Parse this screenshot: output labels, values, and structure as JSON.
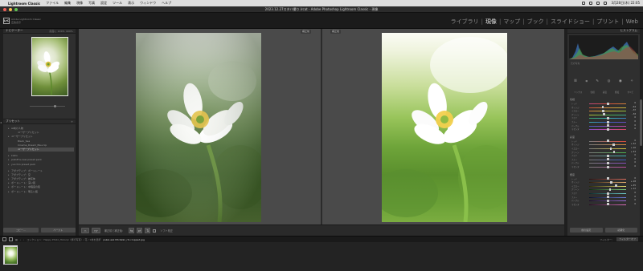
{
  "menubar": {
    "app_name": "Lightroom Classic",
    "menus": [
      "ファイル",
      "編集",
      "現像",
      "写真",
      "設定",
      "ツール",
      "表示",
      "ウィンドウ",
      "ヘルプ"
    ],
    "clock": "3月28日(木) 22:05"
  },
  "window": {
    "title": "2023.12.27スタバ撮り.lrcat - Adobe Photoshop Lightroom Classic - 現像"
  },
  "identity": {
    "logo": "LrC",
    "line1": "Adobe Lightroom Classic",
    "line2": "広告表示"
  },
  "modules": [
    "ライブラリ",
    "現像",
    "マップ",
    "ブック",
    "スライドショー",
    "プリント",
    "Web"
  ],
  "active_module": "現像",
  "navigator": {
    "title": "ナビゲーター",
    "options": "画面に  100%  400%"
  },
  "presets": {
    "title": "プリセット",
    "items": [
      {
        "label": "AI向け人物",
        "level": 0,
        "selected": false
      },
      {
        "label": "ユーザープリセット",
        "level": 1,
        "selected": false
      },
      {
        "label": "ユーザープリセット",
        "level": 0,
        "selected": false
      },
      {
        "label": "Black_Sea",
        "level": 1,
        "selected": false
      },
      {
        "label": "Cinema_Dream_Blue Up",
        "level": 1,
        "selected": false
      },
      {
        "label": "ユーザープリセット",
        "level": 1,
        "selected": true
      },
      {
        "label": "",
        "level": -1,
        "selected": false
      },
      {
        "label": "kisho",
        "level": 0,
        "selected": false
      },
      {
        "label": "Josh#h+new preset pack",
        "level": 0,
        "selected": false
      },
      {
        "label": "yucchin preset pack",
        "level": 0,
        "selected": false
      },
      {
        "label": "",
        "level": -1,
        "selected": false
      },
      {
        "label": "アダプティブ：ポートレート",
        "level": 0,
        "selected": false
      },
      {
        "label": "アダプティブ：空",
        "level": 0,
        "selected": false
      },
      {
        "label": "アダプティブ：被写体",
        "level": 0,
        "selected": false
      },
      {
        "label": "ポートレート：深い肌",
        "level": 0,
        "selected": false
      },
      {
        "label": "ポートレート：中程度の肌",
        "level": 0,
        "selected": false
      },
      {
        "label": "ポートレート：明るい肌",
        "level": 0,
        "selected": false
      }
    ]
  },
  "left_buttons": {
    "copy": "コピー...",
    "paste": "ペースト"
  },
  "compare": {
    "before_label": "補正前",
    "after_label": "補正後"
  },
  "toolbar": {
    "view_yy": "Y|Y",
    "before_after_label": "補正前と補正後：",
    "soft_proof_label": "ソフト校正"
  },
  "histogram": {
    "title": "ヒストグラム",
    "info": "元の写真"
  },
  "develop_panel": {
    "tabs": [
      "ミックス",
      "色相",
      "彩度",
      "輝度",
      "すべて"
    ],
    "sections": [
      {
        "name": "色相",
        "rows": [
          {
            "label": "レッド",
            "value": "0",
            "knob": 0.5,
            "gradient": "linear-gradient(90deg,#c04a7c,#d44a3a,#d2843a)"
          },
          {
            "label": "オレンジ",
            "value": "- 44",
            "knob": 0.36,
            "gradient": "linear-gradient(90deg,#c8503c,#d8903a,#c9b53a)"
          },
          {
            "label": "イエロー",
            "value": "- 37",
            "knob": 0.38,
            "gradient": "linear-gradient(90deg,#d2843a,#d6c23c,#8cbb3a)"
          },
          {
            "label": "グリーン",
            "value": "- 33",
            "knob": 0.4,
            "gradient": "linear-gradient(90deg,#b4c03a,#4fb04a,#3aa88c)"
          },
          {
            "label": "アクア",
            "value": "0",
            "knob": 0.5,
            "gradient": "linear-gradient(90deg,#3aa870,#3ab0b0,#3a7cc0)"
          },
          {
            "label": "ブルー",
            "value": "0",
            "knob": 0.5,
            "gradient": "linear-gradient(90deg,#3aa8b0,#3a5cc0,#6a4cc0)"
          },
          {
            "label": "パープル",
            "value": "0",
            "knob": 0.5,
            "gradient": "linear-gradient(90deg,#4a5cc0,#8a4cc0,#c04aa0)"
          },
          {
            "label": "マゼンタ",
            "value": "0",
            "knob": 0.5,
            "gradient": "linear-gradient(90deg,#8a4cc0,#c04aa0,#d04a5c)"
          }
        ]
      },
      {
        "name": "彩度",
        "rows": [
          {
            "label": "レッド",
            "value": "0",
            "knob": 0.5,
            "gradient": "linear-gradient(90deg,#7a7a7a,#d84a3a)"
          },
          {
            "label": "オレンジ",
            "value": "+ 32",
            "knob": 0.66,
            "gradient": "linear-gradient(90deg,#7a7a7a,#dc8a3a)"
          },
          {
            "label": "イエロー",
            "value": "+ 16",
            "knob": 0.58,
            "gradient": "linear-gradient(90deg,#7a7a7a,#d8c43a)"
          },
          {
            "label": "グリーン",
            "value": "+ 33",
            "knob": 0.67,
            "gradient": "linear-gradient(90deg,#7a7a7a,#4ab04a)"
          },
          {
            "label": "アクア",
            "value": "0",
            "knob": 0.5,
            "gradient": "linear-gradient(90deg,#7a7a7a,#3ab0b0)"
          },
          {
            "label": "ブルー",
            "value": "0",
            "knob": 0.5,
            "gradient": "linear-gradient(90deg,#7a7a7a,#3a5cc0)"
          },
          {
            "label": "パープル",
            "value": "0",
            "knob": 0.5,
            "gradient": "linear-gradient(90deg,#7a7a7a,#8a4cc0)"
          },
          {
            "label": "マゼンタ",
            "value": "0",
            "knob": 0.5,
            "gradient": "linear-gradient(90deg,#7a7a7a,#c04aa0)"
          }
        ]
      },
      {
        "name": "輝度",
        "rows": [
          {
            "label": "レッド",
            "value": "0",
            "knob": 0.5,
            "gradient": "linear-gradient(90deg,#2a1010,#e07060)"
          },
          {
            "label": "オレンジ",
            "value": "+ 18",
            "knob": 0.59,
            "gradient": "linear-gradient(90deg,#2a1a0a,#e8b070)"
          },
          {
            "label": "イエロー",
            "value": "+ 45",
            "knob": 0.72,
            "gradient": "linear-gradient(90deg,#2a2a0a,#ece070)"
          },
          {
            "label": "グリーン",
            "value": "+ 12",
            "knob": 0.56,
            "gradient": "linear-gradient(90deg,#102a10,#80d080)"
          },
          {
            "label": "アクア",
            "value": "0",
            "knob": 0.5,
            "gradient": "linear-gradient(90deg,#0a2a2a,#70d0d0)"
          },
          {
            "label": "ブルー",
            "value": "0",
            "knob": 0.5,
            "gradient": "linear-gradient(90deg,#0a102a,#7080e0)"
          },
          {
            "label": "パープル",
            "value": "0",
            "knob": 0.5,
            "gradient": "linear-gradient(90deg,#1a0a2a,#a070e0)"
          },
          {
            "label": "マゼンタ",
            "value": "0",
            "knob": 0.5,
            "gradient": "linear-gradient(90deg,#2a0a22,#e070c0)"
          }
        ]
      }
    ]
  },
  "right_buttons": {
    "prev": "前の設定",
    "reset": "初期化"
  },
  "filmstrip": {
    "path": "コレクション：Happy Photo_Tokorpi（旅行写真）/ 花 / 1枚を選択",
    "filename": "pskel-ask 83c0a9c_rtr-cropped.jpg",
    "filter_label": "フィルター：",
    "filter_value": "フィルターオフ"
  },
  "colors": {
    "accent": "#ffffff",
    "panel": "#2f2f2f",
    "canvas": "#4a4a4a"
  }
}
